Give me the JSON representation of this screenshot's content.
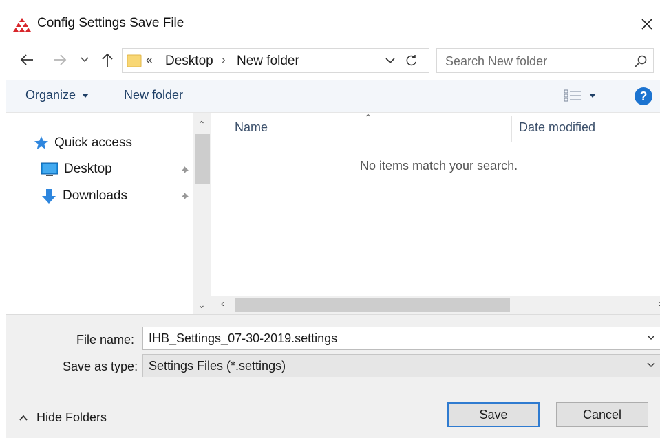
{
  "window": {
    "title": "Config Settings Save File"
  },
  "address": {
    "overflow": "«",
    "crumbs": [
      "Desktop",
      "New folder"
    ],
    "separator": "›"
  },
  "search": {
    "placeholder": "Search New folder"
  },
  "toolbar": {
    "organize_label": "Organize",
    "new_folder_label": "New folder"
  },
  "nav_pane": {
    "items": [
      {
        "label": "Quick access",
        "icon": "star-icon"
      },
      {
        "label": "Desktop",
        "icon": "desktop-icon",
        "pinned": true
      },
      {
        "label": "Downloads",
        "icon": "download-arrow-icon",
        "pinned": true
      }
    ]
  },
  "file_list": {
    "columns": [
      "Name",
      "Date modified"
    ],
    "empty_message": "No items match your search."
  },
  "form": {
    "file_name_label": "File name:",
    "file_name_value": "IHB_Settings_07-30-2019.settings",
    "save_type_label": "Save as type:",
    "save_type_value": "Settings Files (*.settings)"
  },
  "footer": {
    "hide_folders_label": "Hide Folders",
    "save_label": "Save",
    "cancel_label": "Cancel"
  },
  "colors": {
    "accent": "#1b73d0",
    "toolbar_bg": "#f3f6fa",
    "logo_red": "#d8262b"
  }
}
